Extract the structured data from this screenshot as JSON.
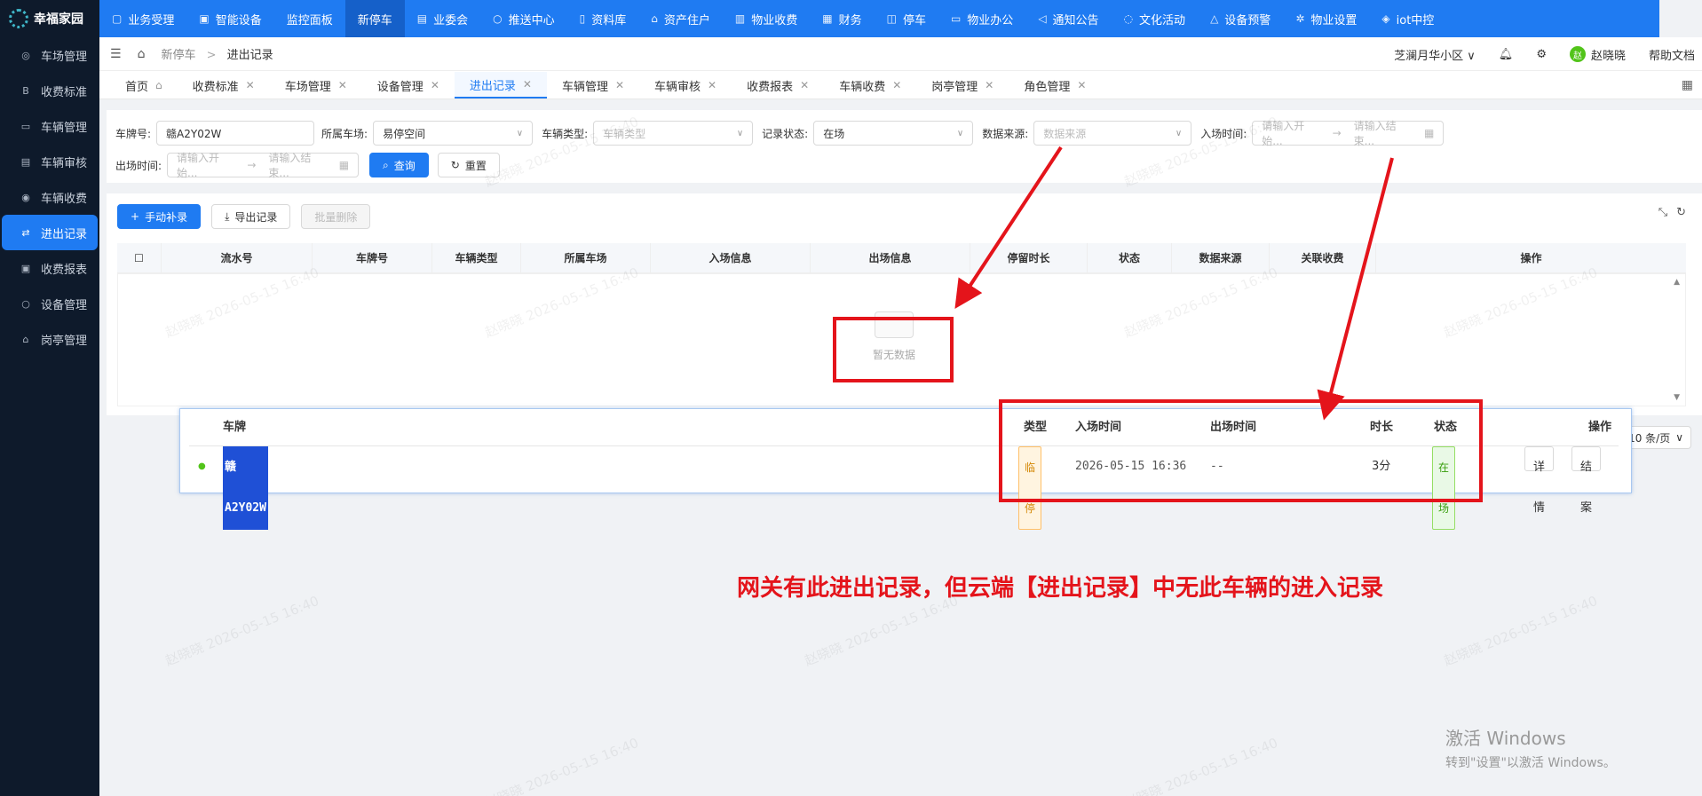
{
  "app": {
    "logo": "幸福家园"
  },
  "sidebar": {
    "items": [
      {
        "label": "车场管理",
        "icon": "car-icon"
      },
      {
        "label": "收费标准",
        "icon": "fee-standard-icon"
      },
      {
        "label": "车辆管理",
        "icon": "vehicle-icon"
      },
      {
        "label": "车辆审核",
        "icon": "audit-icon"
      },
      {
        "label": "车辆收费",
        "icon": "coin-icon"
      },
      {
        "label": "进出记录",
        "icon": "record-icon"
      },
      {
        "label": "收费报表",
        "icon": "report-icon"
      },
      {
        "label": "设备管理",
        "icon": "device-icon"
      },
      {
        "label": "岗亭管理",
        "icon": "booth-icon"
      }
    ],
    "active_index": 5
  },
  "topnav": {
    "items": [
      "业务受理",
      "智能设备",
      "监控面板",
      "新停车",
      "业委会",
      "推送中心",
      "资料库",
      "资产住户",
      "物业收费",
      "财务",
      "停车",
      "物业办公",
      "通知公告",
      "文化活动",
      "设备预警",
      "物业设置",
      "iot中控"
    ],
    "active": "新停车"
  },
  "header": {
    "breadcrumb": [
      "新停车",
      "进出记录"
    ],
    "community": "芝澜月华小区",
    "user": "赵晓晓",
    "avatar_text": "赵",
    "help": "帮助文档"
  },
  "tabs": [
    {
      "label": "首页"
    },
    {
      "label": "收费标准"
    },
    {
      "label": "车场管理"
    },
    {
      "label": "设备管理"
    },
    {
      "label": "进出记录"
    },
    {
      "label": "车辆管理"
    },
    {
      "label": "车辆审核"
    },
    {
      "label": "收费报表"
    },
    {
      "label": "车辆收费"
    },
    {
      "label": "岗亭管理"
    },
    {
      "label": "角色管理"
    }
  ],
  "filters": {
    "plate_label": "车牌号:",
    "plate_value": "赣A2Y02W",
    "lot_label": "所属车场:",
    "lot_value": "易停空间",
    "type_label": "车辆类型:",
    "type_placeholder": "车辆类型",
    "status_label": "记录状态:",
    "status_value": "在场",
    "source_label": "数据来源:",
    "source_placeholder": "数据来源",
    "entry_label": "入场时间:",
    "entry_start": "请输入开始...",
    "entry_end": "请输入结束...",
    "exit_label": "出场时间:",
    "exit_start": "请输入开始...",
    "exit_end": "请输入结束...",
    "search": "查询",
    "reset": "重置"
  },
  "actions": {
    "add": "手动补录",
    "export": "导出记录",
    "batch_delete": "批量删除"
  },
  "table": {
    "columns": [
      "流水号",
      "车牌号",
      "车辆类型",
      "所属车场",
      "入场信息",
      "出场信息",
      "停留时长",
      "状态",
      "数据来源",
      "关联收费",
      "操作"
    ],
    "empty": "暂无数据"
  },
  "gateway": {
    "columns": {
      "plate": "车牌",
      "type": "类型",
      "entry": "入场时间",
      "exit": "出场时间",
      "duration": "时长",
      "status": "状态",
      "op": "操作"
    },
    "row": {
      "plate": "赣A2Y02W",
      "type": "临停",
      "entry": "2026-05-15 16:36",
      "exit": "--",
      "duration": "3分",
      "status": "在场",
      "detail": "详情",
      "settle": "结案"
    }
  },
  "pager": "10 条/页",
  "annotation": "网关有此进出记录，但云端【进出记录】中无此车辆的进入记录",
  "watermark": "赵晓晓 2026-05-15 16:40",
  "windows": {
    "line1": "激活 Windows",
    "line2": "转到\"设置\"以激活 Windows。"
  },
  "colors": {
    "primary": "#1f7bf2",
    "sidebar": "#0e1a2b",
    "annotation": "#e4141b"
  }
}
